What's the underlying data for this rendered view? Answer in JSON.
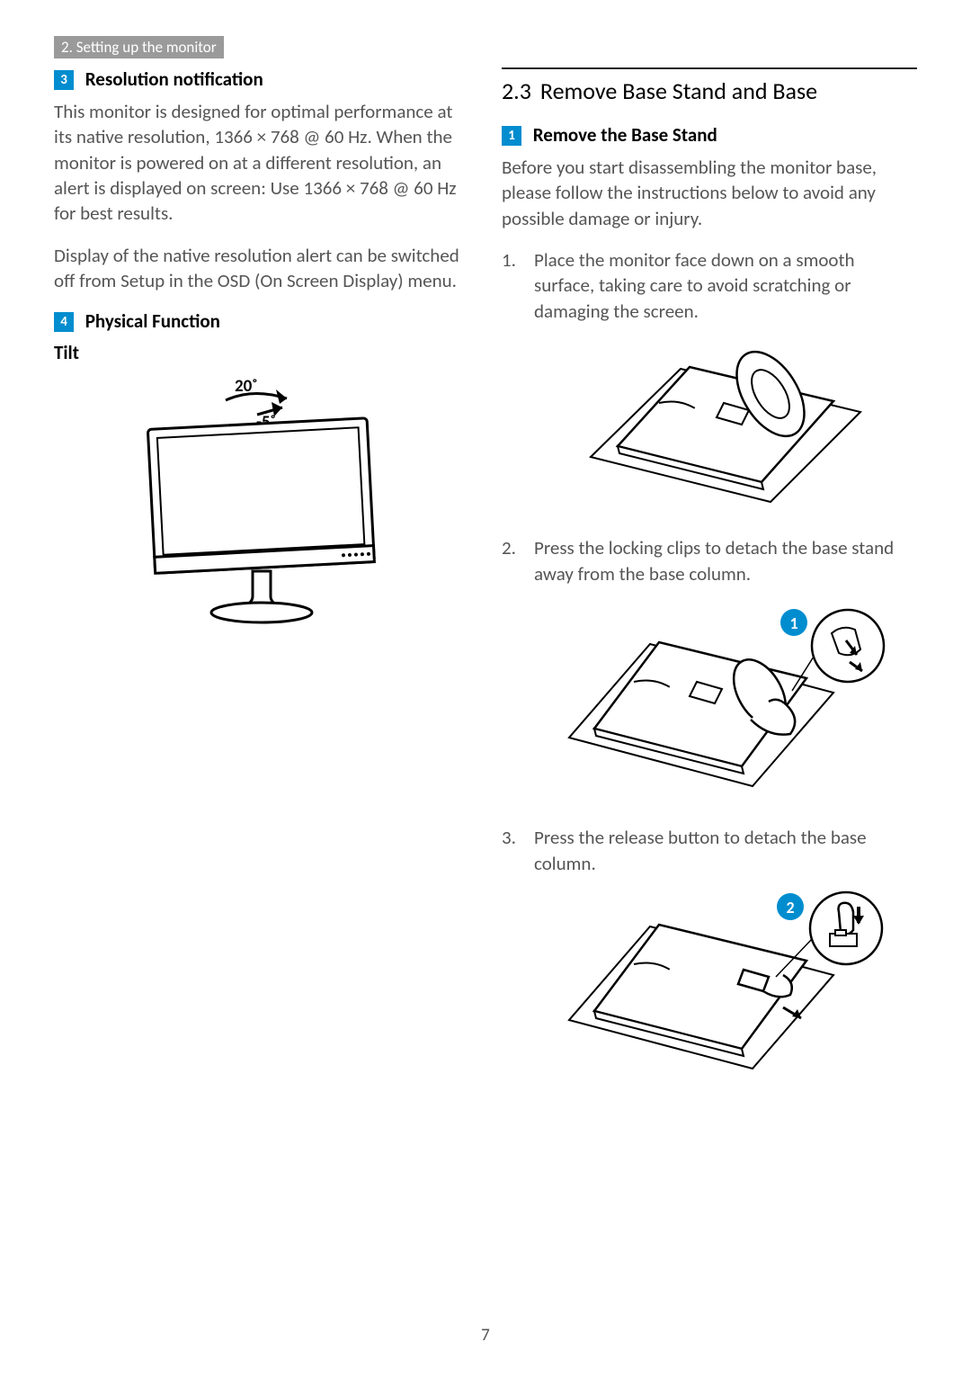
{
  "header": {
    "tab": "2. Setting up the monitor"
  },
  "left": {
    "badge3": "3",
    "heading3": "Resolution notification",
    "para1": "This monitor is designed for optimal performance at its native resolution, 1366 × 768 @ 60 Hz. When the monitor is powered on at a different resolution, an alert is displayed on screen: Use 1366 × 768 @ 60 Hz for best results.",
    "para2": "Display of the native resolution alert can be switched off from Setup in the OSD (On Screen Display) menu.",
    "badge4": "4",
    "heading4": "Physical Function",
    "tilt_label": "Tilt",
    "angle_up": "20˚",
    "angle_down": "-5˚"
  },
  "right": {
    "section_num": "2.3",
    "section_title": "Remove Base Stand and Base",
    "badge1": "1",
    "heading1": "Remove the Base Stand",
    "intro": "Before you start disassembling the monitor base, please follow the instructions below to avoid any possible damage or injury.",
    "step1": "Place the monitor face down on a smooth surface, taking care to avoid scratching or damaging the screen.",
    "step2": "Press the locking clips to detach the base stand away from the base column.",
    "step3": "Press the release button to detach the base column.",
    "callout1": "1",
    "callout2": "2"
  },
  "page_number": "7"
}
